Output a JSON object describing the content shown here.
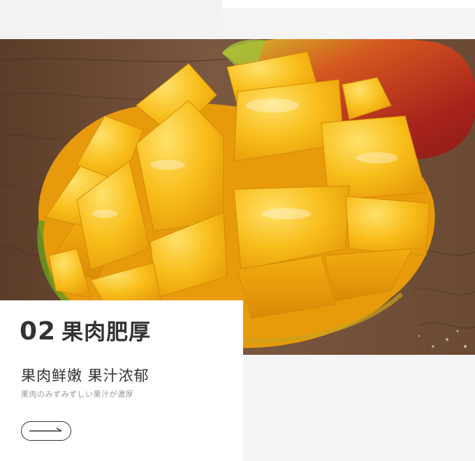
{
  "feature": {
    "number": "02",
    "title": "果肉肥厚",
    "subtitle": "果肉鲜嫩 果汁浓郁",
    "note": "果肉のみずみずしい果汁が濃厚"
  },
  "arrow_button": {
    "icon": "long-arrow-right-icon"
  },
  "colors": {
    "mango_flesh": "#f5b714",
    "mango_highlight": "#ffd84a",
    "mango_skin_red": "#c0392b",
    "mango_skin_green": "#7fa52a",
    "wood": "#6a4a33",
    "text_dark": "#333333",
    "text_light": "#999999"
  }
}
